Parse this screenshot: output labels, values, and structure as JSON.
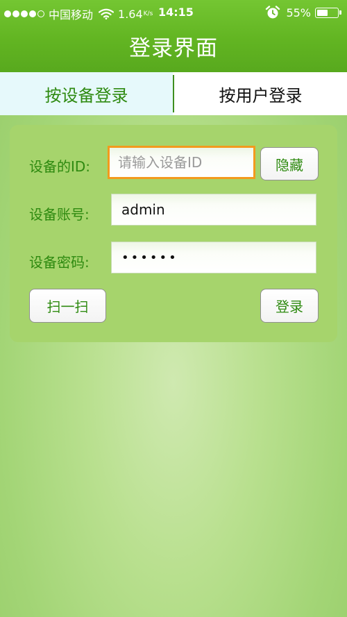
{
  "status_bar": {
    "carrier": "中国移动",
    "network_speed": "1.64",
    "network_speed_unit": "K/s",
    "time": "14:15",
    "battery_percent": "55%",
    "battery_level": 0.55,
    "signal_strength": 4,
    "signal_max": 5,
    "icons": [
      "signal-dots",
      "wifi-icon",
      "alarm-icon",
      "battery-icon"
    ]
  },
  "header": {
    "title": "登录界面"
  },
  "tabs": [
    {
      "label": "按设备登录",
      "active": true
    },
    {
      "label": "按用户登录",
      "active": false
    }
  ],
  "form": {
    "device_id": {
      "label": "设备的ID:",
      "value": "",
      "placeholder": "请输入设备ID",
      "focused": true
    },
    "hide_button": "隐藏",
    "account": {
      "label": "设备账号:",
      "value": "admin"
    },
    "password": {
      "label": "设备密码:",
      "value": "••••••"
    },
    "scan_button": "扫一扫",
    "login_button": "登录"
  },
  "colors": {
    "header_green": "#62b522",
    "label_green": "#2e8a10",
    "card_green": "#a6d46c",
    "focus_orange": "#f39a1d",
    "active_tab_bg": "#e6f9fb"
  }
}
